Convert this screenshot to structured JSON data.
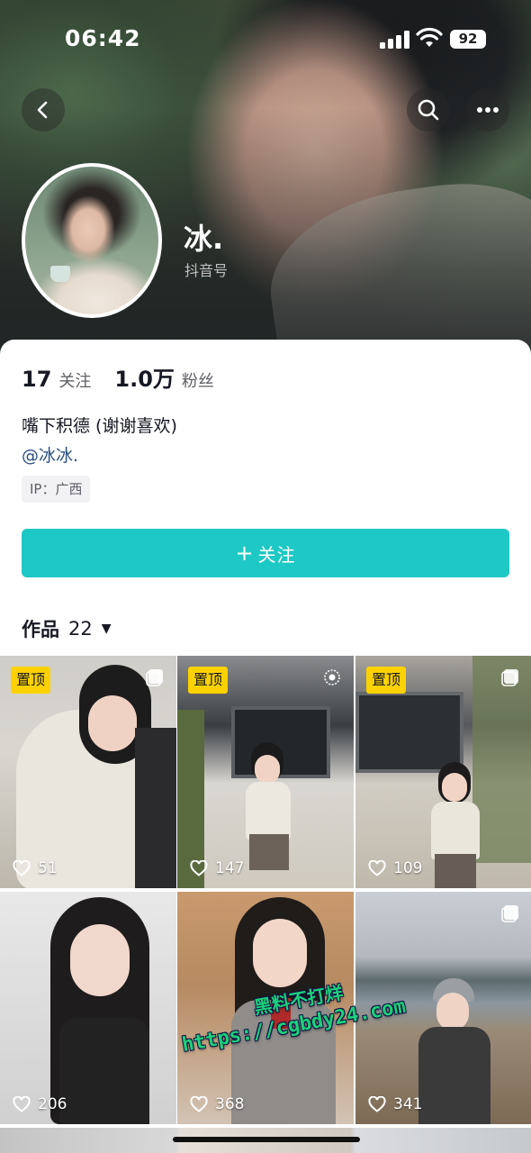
{
  "status_bar": {
    "time": "06:42",
    "battery": "92"
  },
  "header": {
    "back_icon": "chevron-left-icon",
    "search_icon": "search-icon",
    "more_icon": "more-horizontal-icon"
  },
  "profile": {
    "nickname": "冰.",
    "douyin_id_label": "抖音号",
    "following_count": "17",
    "following_label": "关注",
    "followers_count": "1.0万",
    "followers_label": "粉丝",
    "bio": "嘴下积德 (谢谢喜欢)",
    "mention": "@冰冰.",
    "ip": "IP：广西"
  },
  "actions": {
    "follow_plus": "+",
    "follow_label": "关注"
  },
  "works": {
    "tab_label": "作品",
    "count": "22",
    "items": [
      {
        "pinned": "置顶",
        "likes": "51"
      },
      {
        "pinned": "置顶",
        "likes": "147"
      },
      {
        "pinned": "置顶",
        "likes": "109"
      },
      {
        "pinned": "",
        "likes": "206"
      },
      {
        "pinned": "",
        "likes": "368"
      },
      {
        "pinned": "",
        "likes": "341"
      }
    ]
  },
  "watermark": {
    "line1": "黑料不打烊",
    "line2": "https://cgbdy24.com"
  },
  "colors": {
    "follow_button": "#1ec8c4",
    "pin_badge": "#fbd200",
    "mention": "#2a4f7f"
  }
}
